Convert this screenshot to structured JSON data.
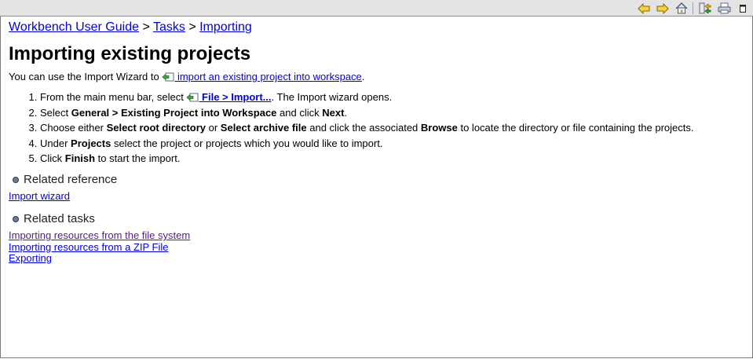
{
  "toolbar": {
    "buttons": [
      {
        "icon": "back-arrow-icon",
        "tooltip": ""
      },
      {
        "icon": "forward-arrow-icon",
        "tooltip": ""
      },
      {
        "icon": "home-icon",
        "tooltip": ""
      },
      {
        "icon": "sync-toc-icon",
        "tooltip": ""
      },
      {
        "icon": "print-icon",
        "tooltip": ""
      },
      {
        "icon": "maximize-icon",
        "tooltip": ""
      }
    ],
    "colors": {
      "background": "#e4e4e4",
      "arrow": "#f2c200"
    }
  },
  "breadcrumb": {
    "items": [
      "Workbench User Guide",
      "Tasks",
      "Importing"
    ],
    "separator": ">"
  },
  "page": {
    "title": "Importing existing projects",
    "intro_prefix": "You can use the Import Wizard to ",
    "intro_link": " import an existing project into workspace",
    "intro_suffix": ".",
    "steps": [
      {
        "a": "From the main menu bar, select ",
        "link": " File > Import...",
        "b": ". The Import wizard opens."
      },
      {
        "a": "Select ",
        "b1": "General > Existing Project into Workspace",
        "c": " and click ",
        "b2": "Next",
        "d": "."
      },
      {
        "a": "Choose either ",
        "b1": "Select root directory",
        "c": " or ",
        "b2": "Select archive file",
        "d": " and click the associated ",
        "b3": "Browse",
        "e": " to locate the directory or file containing the projects."
      },
      {
        "a": "Under ",
        "b1": "Projects",
        "c": " select the project or projects which you would like to import."
      },
      {
        "a": "Click ",
        "b1": "Finish",
        "c": " to start the import."
      }
    ]
  },
  "related_reference": {
    "heading": "Related reference",
    "links": [
      "Import wizard"
    ]
  },
  "related_tasks": {
    "heading": "Related tasks",
    "links": [
      "Importing resources from the file system",
      "Importing resources from a ZIP File",
      "Exporting"
    ]
  },
  "colors": {
    "link": "#0000ee",
    "visited_link": "#551a8b",
    "bullet": "#6f7b8f"
  }
}
